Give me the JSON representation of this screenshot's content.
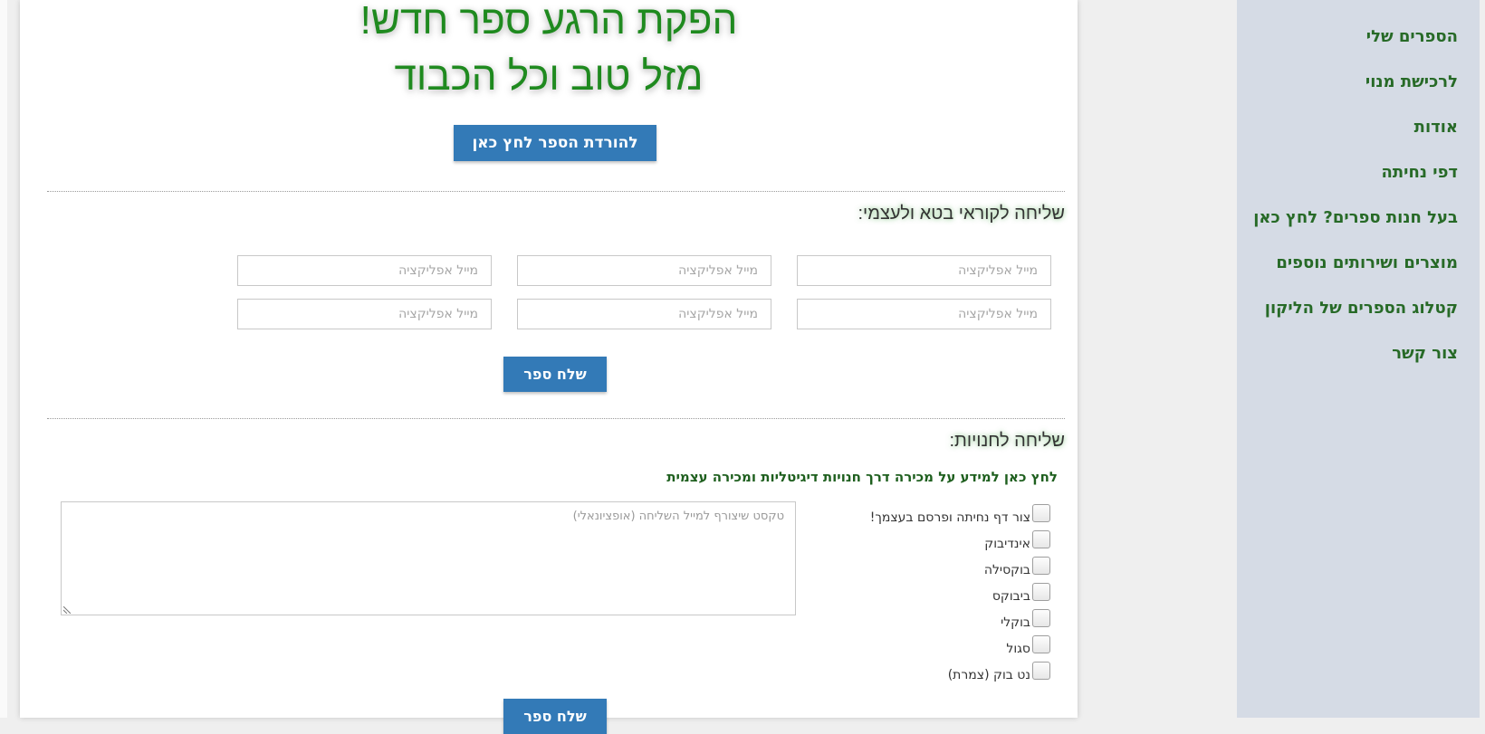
{
  "hero": {
    "line1": "הפקת הרגע ספר חדש!",
    "line2": "מזל טוב וכל הכבוד",
    "download_label": "להורדת הספר לחץ כאן"
  },
  "beta": {
    "heading": "שליחה לקוראי בטא ולעצמי:",
    "email_placeholder": "מייל אפליקציה",
    "send_label": "שלח ספר"
  },
  "stores": {
    "heading": "שליחה לחנויות:",
    "info_link": "לחץ כאן למידע על מכירה דרך חנויות דיגיטליות ומכירה עצמית",
    "note_placeholder": "טקסט שיצורף למייל השליחה (אופציונאלי)",
    "options": [
      "צור דף נחיתה ופרסם בעצמך!",
      "אינדיבוק",
      "בוקסילה",
      "ביבוקס",
      "בוקלי",
      "סגול",
      "נט בוק (צמרת)"
    ],
    "send_label": "שלח ספר"
  },
  "sidebar": {
    "items": [
      "הספרים שלי",
      "לרכישת מנוי",
      "אודות",
      "דפי נחיתה",
      "בעל חנות ספרים? לחץ כאן",
      "מוצרים ושירותים נוספים",
      "קטלוג הספרים של הליקון",
      "צור קשר"
    ]
  },
  "colors": {
    "accent_button": "#337ab7",
    "green_text": "#276a27",
    "sidebar_bg": "#d5dbe5"
  }
}
